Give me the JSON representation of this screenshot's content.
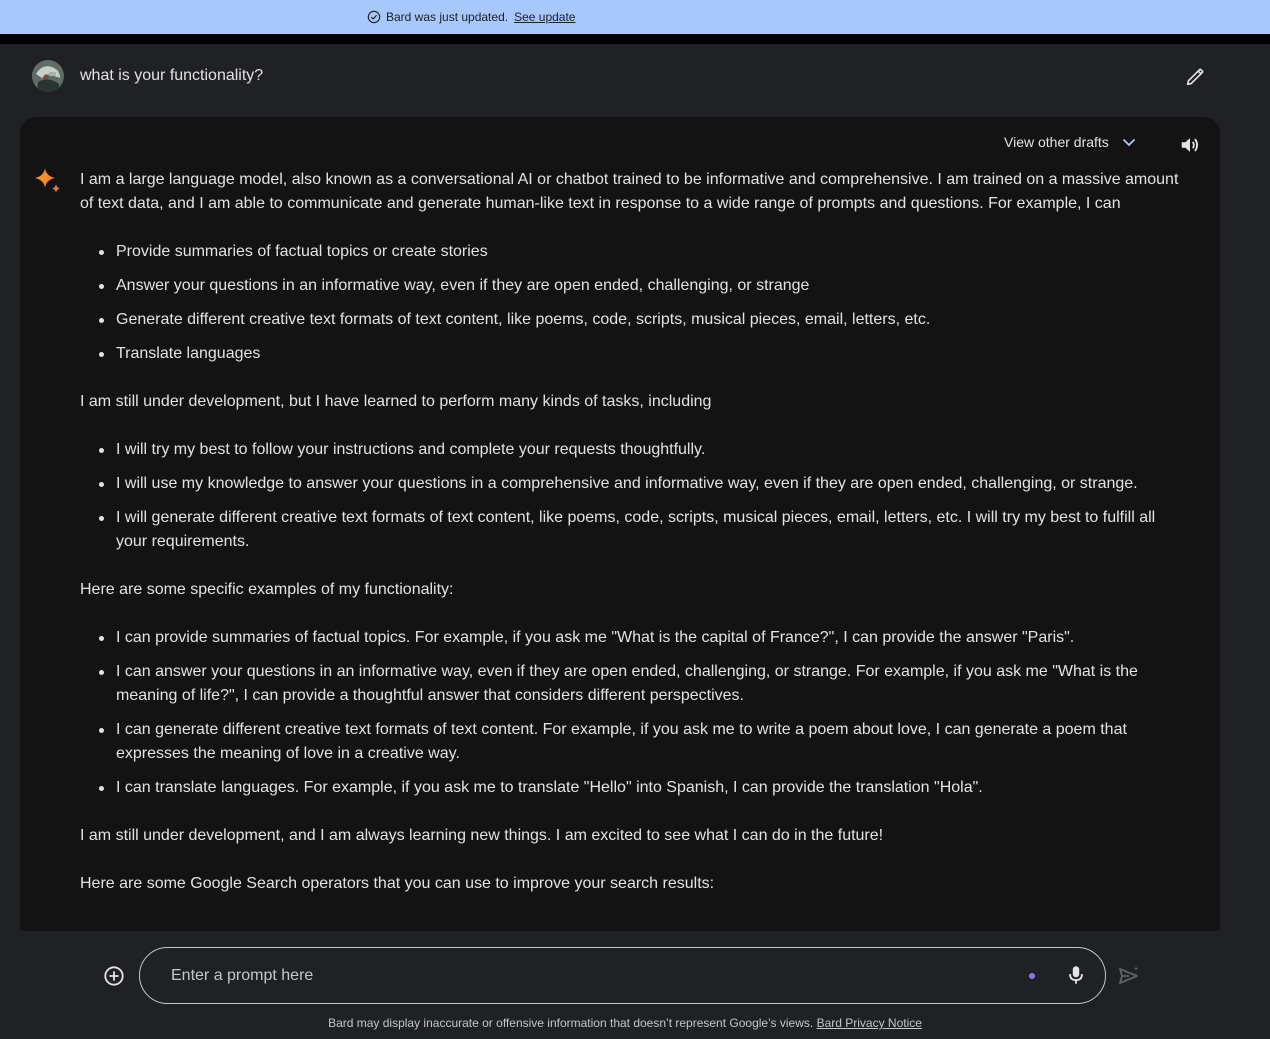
{
  "banner": {
    "message": "Bard was just updated.",
    "link": "See update"
  },
  "user": {
    "prompt": "what is your functionality?"
  },
  "response": {
    "drafts_label": "View other drafts",
    "intro": "I am a large language model, also known as a conversational AI or chatbot trained to be informative and comprehensive. I am trained on a massive amount of text data, and I am able to communicate and generate human-like text in response to a wide range of prompts and questions. For example, I can",
    "list1": [
      "Provide summaries of factual topics or create stories",
      "Answer your questions in an informative way, even if they are open ended, challenging, or strange",
      "Generate different creative text formats of text content, like poems, code, scripts, musical pieces, email, letters, etc.",
      "Translate languages"
    ],
    "para2": "I am still under development, but I have learned to perform many kinds of tasks, including",
    "list2": [
      "I will try my best to follow your instructions and complete your requests thoughtfully.",
      "I will use my knowledge to answer your questions in a comprehensive and informative way, even if they are open ended, challenging, or strange.",
      "I will generate different creative text formats of text content, like poems, code, scripts, musical pieces, email, letters, etc. I will try my best to fulfill all your requirements."
    ],
    "para3": "Here are some specific examples of my functionality:",
    "list3": [
      "I can provide summaries of factual topics. For example, if you ask me \"What is the capital of France?\", I can provide the answer \"Paris\".",
      "I can answer your questions in an informative way, even if they are open ended, challenging, or strange. For example, if you ask me \"What is the meaning of life?\", I can provide a thoughtful answer that considers different perspectives.",
      "I can generate different creative text formats of text content. For example, if you ask me to write a poem about love, I can generate a poem that expresses the meaning of love in a creative way.",
      "I can translate languages. For example, if you ask me to translate \"Hello\" into Spanish, I can provide the translation \"Hola\"."
    ],
    "para4": "I am still under development, and I am always learning new things. I am excited to see what I can do in the future!",
    "para5": "Here are some Google Search operators that you can use to improve your search results:"
  },
  "input": {
    "placeholder": "Enter a prompt here"
  },
  "footer": {
    "disclaimer": "Bard may display inaccurate or offensive information that doesn’t represent Google’s views.",
    "privacy_link": "Bard Privacy Notice"
  },
  "icons": {
    "banner": "check-circle-icon",
    "edit": "pencil-icon",
    "drafts": "chevron-down-icon",
    "speaker": "speaker-icon",
    "bard": "sparkle-icon",
    "add": "add-circle-icon",
    "mic": "microphone-icon",
    "send": "send-icon"
  },
  "colors": {
    "banner_bg": "#a8c7fa",
    "page_bg": "#202124",
    "card_bg": "#131314",
    "text": "#e3e3e3",
    "accent_dot": "#8a74f0"
  }
}
